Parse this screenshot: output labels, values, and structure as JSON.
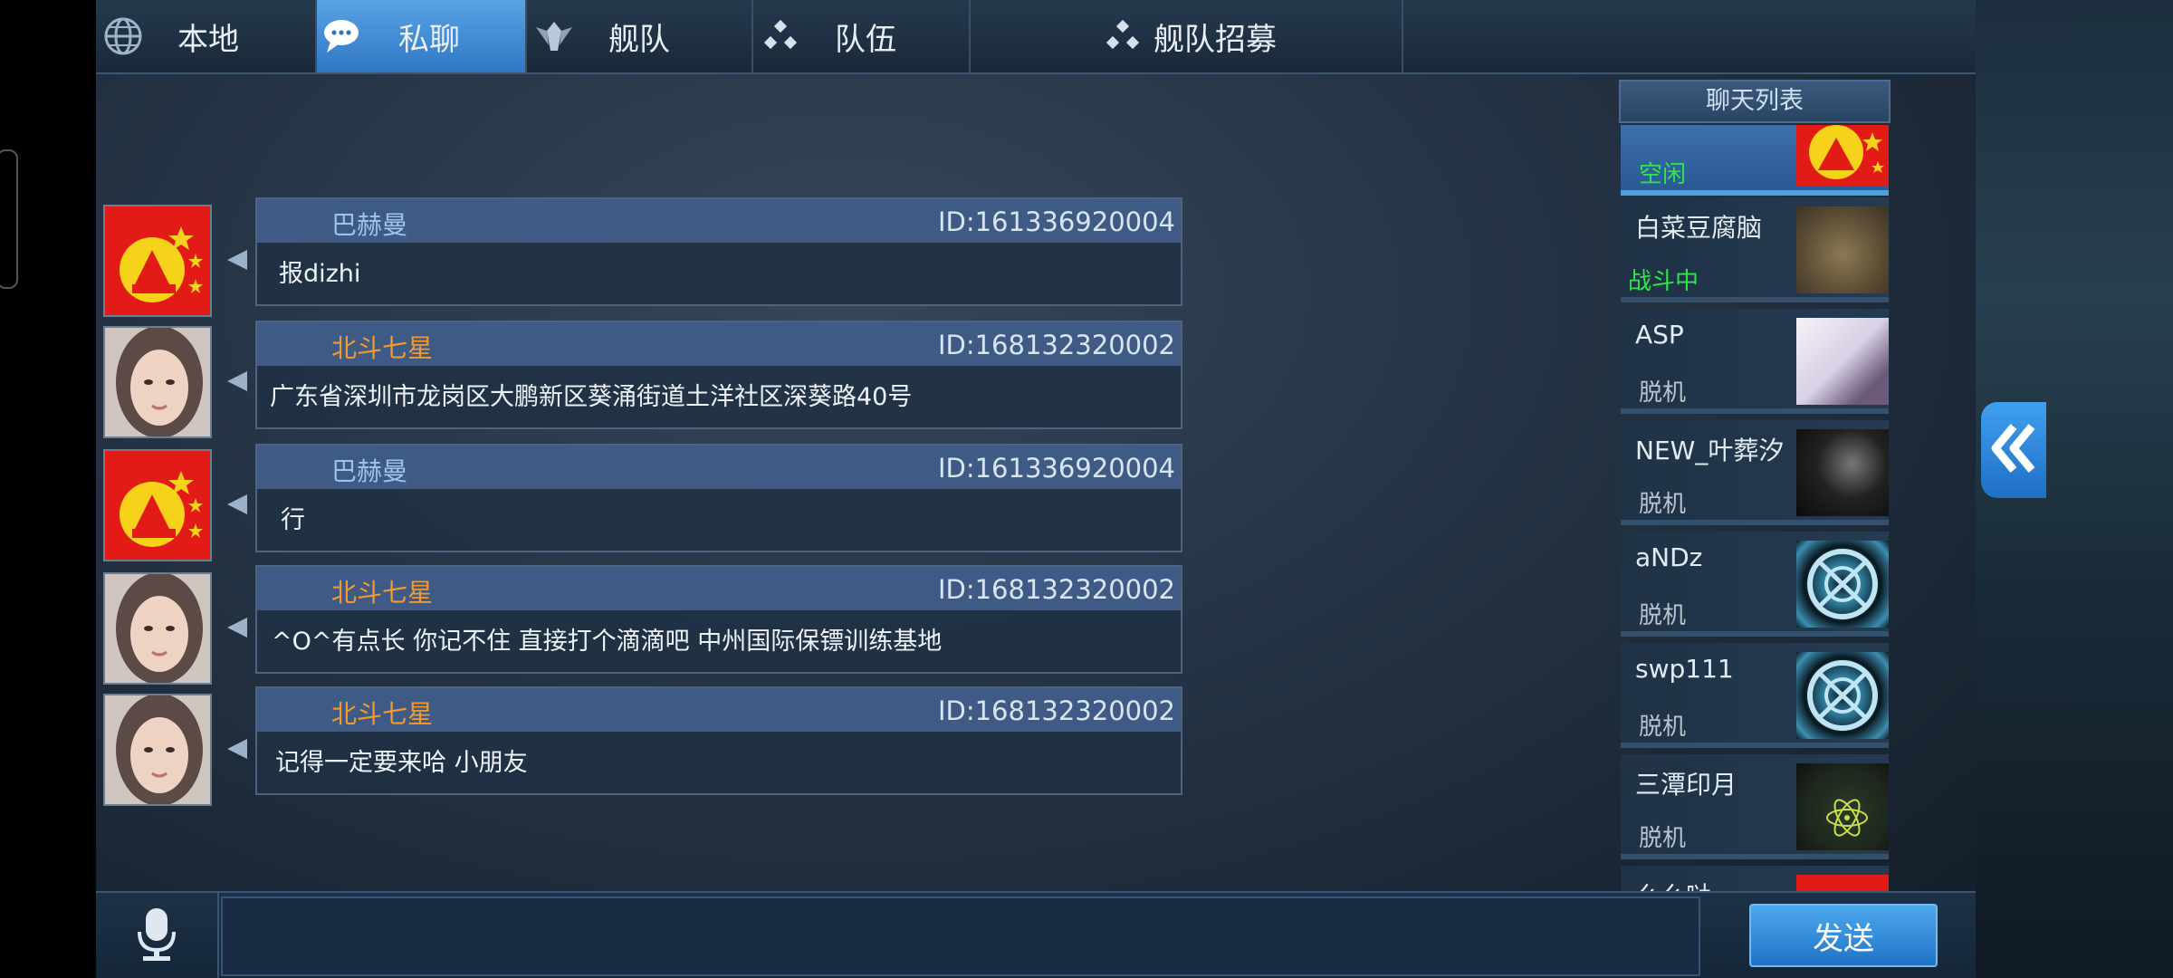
{
  "tabs": [
    {
      "label": "本地",
      "icon": "globe-icon",
      "active": false
    },
    {
      "label": "私聊",
      "icon": "chat-bubble-icon",
      "active": true
    },
    {
      "label": "舰队",
      "icon": "fleet-emblem-icon",
      "active": false
    },
    {
      "label": "队伍",
      "icon": "team-dots-icon",
      "active": false
    },
    {
      "label": "舰队招募",
      "icon": "team-dots-icon",
      "active": false
    }
  ],
  "messages": [
    {
      "sender": "巴赫曼",
      "id": "ID:161336920004",
      "text": "报dizhi",
      "name_color": "blue",
      "avatar": "flag"
    },
    {
      "sender": "北斗七星",
      "id": "ID:168132320002",
      "text": "广东省深圳市龙岗区大鹏新区葵涌街道土洋社区深葵路40号",
      "name_color": "orange",
      "avatar": "girl"
    },
    {
      "sender": "巴赫曼",
      "id": "ID:161336920004",
      "text": "行",
      "name_color": "blue",
      "avatar": "flag"
    },
    {
      "sender": "北斗七星",
      "id": "ID:168132320002",
      "text": "^O^有点长 你记不住 直接打个滴滴吧 中州国际保镖训练基地",
      "name_color": "orange",
      "avatar": "girl"
    },
    {
      "sender": "北斗七星",
      "id": "ID:168132320002",
      "text": "记得一定要来哈 小朋友",
      "name_color": "orange",
      "avatar": "girl"
    }
  ],
  "chat_list": {
    "title": "聊天列表",
    "items": [
      {
        "name": "",
        "status": "空闲",
        "status_type": "idle",
        "pic": "flag",
        "active": true
      },
      {
        "name": "白菜豆腐脑",
        "status": "战斗中",
        "status_type": "fight",
        "pic": "old"
      },
      {
        "name": "ASP",
        "status": "脱机",
        "status_type": "off",
        "pic": "anime"
      },
      {
        "name": "NEW_叶葬汐",
        "status": "脱机",
        "status_type": "off",
        "pic": "dark"
      },
      {
        "name": "aNDz",
        "status": "脱机",
        "status_type": "off",
        "pic": "emblem"
      },
      {
        "name": "swp111",
        "status": "脱机",
        "status_type": "off",
        "pic": "emblem"
      },
      {
        "name": "三潭印月",
        "status": "脱机",
        "status_type": "off",
        "pic": "green"
      },
      {
        "name": "么么哒",
        "status": "",
        "status_type": "off",
        "pic": "flag"
      }
    ]
  },
  "input": {
    "value": "",
    "placeholder": ""
  },
  "send_label": "发送",
  "colors": {
    "accent": "#2f77c2",
    "idle_green": "#2fe64a",
    "name_orange": "#f29a2e",
    "name_blue": "#9bc3ee"
  }
}
